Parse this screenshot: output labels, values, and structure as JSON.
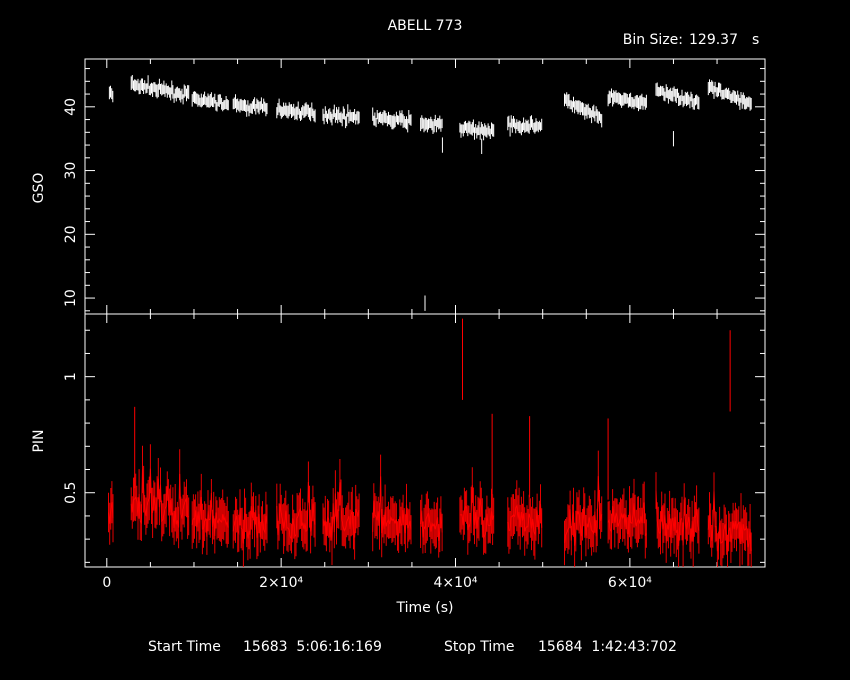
{
  "header": {
    "title": "ABELL 773",
    "bin_label": "Bin Size:",
    "bin_value": "129.37",
    "bin_unit": "s"
  },
  "footer": {
    "start_label": "Start Time",
    "start_value": "15683  5:06:16:169",
    "stop_label": "Stop Time",
    "stop_value": "15684  1:42:43:702"
  },
  "chart_data": [
    {
      "type": "scatter",
      "ylabel": "GSO",
      "xlabel": "",
      "xlim": [
        -2500,
        75500
      ],
      "ylim": [
        7.5,
        47.5
      ],
      "x_ticks": [
        "0",
        "2×10⁴",
        "4×10⁴",
        "6×10⁴"
      ],
      "x_tick_values": [
        0,
        20000,
        40000,
        60000
      ],
      "y_ticks": [
        "10",
        "20",
        "30",
        "40"
      ],
      "y_tick_values": [
        10,
        20,
        30,
        40
      ],
      "color": "#ffffff",
      "segments": [
        {
          "t0": 300,
          "t1": 700,
          "y0": 42.5,
          "y1": 41.5
        },
        {
          "t0": 2800,
          "t1": 9500,
          "y0": 43.5,
          "y1": 41.8
        },
        {
          "t0": 9800,
          "t1": 14000,
          "y0": 41.2,
          "y1": 40.4
        },
        {
          "t0": 14500,
          "t1": 18500,
          "y0": 40.2,
          "y1": 39.8
        },
        {
          "t0": 19500,
          "t1": 24000,
          "y0": 39.6,
          "y1": 39.0
        },
        {
          "t0": 24800,
          "t1": 29000,
          "y0": 38.8,
          "y1": 38.4
        },
        {
          "t0": 30500,
          "t1": 35000,
          "y0": 38.2,
          "y1": 37.7
        },
        {
          "t0": 36000,
          "t1": 38500,
          "y0": 37.5,
          "y1": 37.0
        },
        {
          "t0": 40500,
          "t1": 44500,
          "y0": 36.6,
          "y1": 36.2
        },
        {
          "t0": 46000,
          "t1": 50000,
          "y0": 37.2,
          "y1": 37.0
        },
        {
          "t0": 52500,
          "t1": 56800,
          "y0": 41.0,
          "y1": 38.0
        },
        {
          "t0": 57500,
          "t1": 62000,
          "y0": 41.5,
          "y1": 40.5
        },
        {
          "t0": 63000,
          "t1": 68000,
          "y0": 42.5,
          "y1": 40.8
        },
        {
          "t0": 69000,
          "t1": 74000,
          "y0": 43.0,
          "y1": 40.5
        }
      ],
      "outliers": [
        {
          "x": 38500,
          "y": 34.0
        },
        {
          "x": 43000,
          "y": 33.8
        },
        {
          "x": 65000,
          "y": 35.0
        },
        {
          "x": 36500,
          "y": 9.2
        }
      ]
    },
    {
      "type": "line",
      "ylabel": "PIN",
      "xlabel": "Time (s)",
      "xlim": [
        -2500,
        75500
      ],
      "ylim": [
        0.18,
        1.27
      ],
      "x_ticks": [
        "0",
        "2×10⁴",
        "4×10⁴",
        "6×10⁴"
      ],
      "x_tick_values": [
        0,
        20000,
        40000,
        60000
      ],
      "y_ticks": [
        "0.5",
        "1"
      ],
      "y_tick_values": [
        0.5,
        1.0
      ],
      "color": "#ff0000",
      "segments": [
        {
          "t0": 200,
          "t1": 800,
          "mean": 0.42
        },
        {
          "t0": 2800,
          "t1": 9500,
          "mean": 0.42
        },
        {
          "t0": 9800,
          "t1": 14000,
          "mean": 0.39
        },
        {
          "t0": 14500,
          "t1": 18500,
          "mean": 0.37
        },
        {
          "t0": 19500,
          "t1": 24000,
          "mean": 0.38
        },
        {
          "t0": 24800,
          "t1": 29000,
          "mean": 0.38
        },
        {
          "t0": 30500,
          "t1": 35000,
          "mean": 0.36
        },
        {
          "t0": 36000,
          "t1": 38500,
          "mean": 0.36
        },
        {
          "t0": 40500,
          "t1": 44500,
          "mean": 0.39
        },
        {
          "t0": 46000,
          "t1": 50000,
          "mean": 0.38
        },
        {
          "t0": 52500,
          "t1": 56800,
          "mean": 0.36
        },
        {
          "t0": 57500,
          "t1": 62000,
          "mean": 0.38
        },
        {
          "t0": 63000,
          "t1": 68000,
          "mean": 0.36
        },
        {
          "t0": 69000,
          "t1": 74000,
          "mean": 0.33
        }
      ],
      "spikes": [
        {
          "x": 3200,
          "y": 0.87
        },
        {
          "x": 40800,
          "y": 1.25
        },
        {
          "x": 44200,
          "y": 0.84
        },
        {
          "x": 48500,
          "y": 0.83
        },
        {
          "x": 57500,
          "y": 0.82
        },
        {
          "x": 71500,
          "y": 1.2
        }
      ]
    }
  ]
}
